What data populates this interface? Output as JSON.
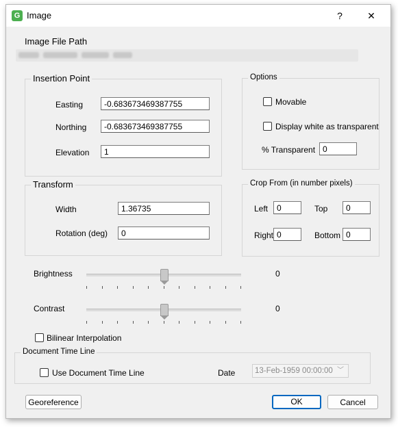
{
  "window": {
    "title": "Image",
    "help_glyph": "?",
    "close_glyph": "✕",
    "app_icon_glyph": "G"
  },
  "file_path": {
    "label": "Image File Path",
    "value": "C:\\Users\\...\\Image.png"
  },
  "insertion_point": {
    "title": "Insertion Point",
    "easting_label": "Easting",
    "easting_value": "-0.683673469387755",
    "northing_label": "Northing",
    "northing_value": "-0.683673469387755",
    "elevation_label": "Elevation",
    "elevation_value": "1"
  },
  "options": {
    "title": "Options",
    "movable_label": "Movable",
    "white_transparent_label": "Display white as transparent",
    "transparent_label": "% Transparent",
    "transparent_value": "0"
  },
  "transform": {
    "title": "Transform",
    "width_label": "Width",
    "width_value": "1.36735",
    "rotation_label": "Rotation (deg)",
    "rotation_value": "0"
  },
  "crop": {
    "title": "Crop From (in number pixels)",
    "left_label": "Left",
    "left_value": "0",
    "top_label": "Top",
    "top_value": "0",
    "right_label": "Right",
    "right_value": "0",
    "bottom_label": "Bottom",
    "bottom_value": "0"
  },
  "brightness": {
    "label": "Brightness",
    "value": "0",
    "position_fraction": 0.5
  },
  "contrast": {
    "label": "Contrast",
    "value": "0",
    "position_fraction": 0.5
  },
  "bilinear_label": "Bilinear Interpolation",
  "time_line": {
    "title": "Document Time Line",
    "use_label": "Use Document Time Line",
    "date_label": "Date",
    "date_value": "13-Feb-1959 00:00:00"
  },
  "buttons": {
    "georeference": "Georeference",
    "ok": "OK",
    "cancel": "Cancel"
  },
  "colors": {
    "accent": "#0067c0",
    "dialog_bg": "#f0f0f0",
    "app_icon": "#4caf50"
  }
}
